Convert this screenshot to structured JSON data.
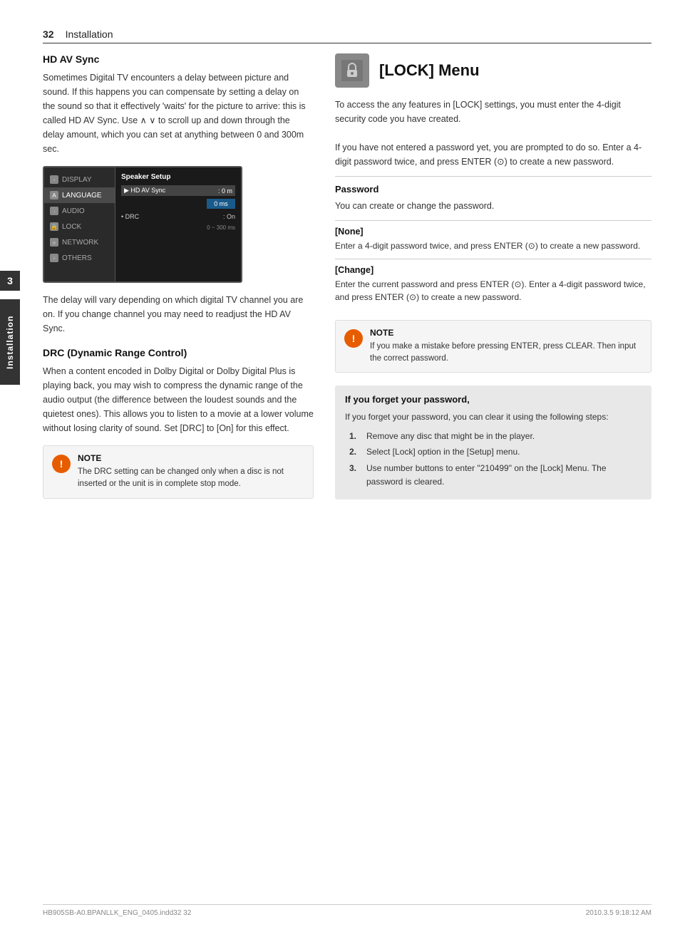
{
  "page": {
    "number": "32",
    "chapter": "Installation",
    "footer_left": "HB905SB-A0.BPANLLK_ENG_0405.indd32   32",
    "footer_right": "2010.3.5   9:18:12 AM"
  },
  "side_tab": {
    "number": "3",
    "label": "Installation"
  },
  "left_section": {
    "hd_av_sync": {
      "heading": "HD AV Sync",
      "body1": "Sometimes Digital TV encounters a delay between picture and sound. If this happens you can compensate by setting a delay on the sound so that it effectively 'waits' for the picture to arrive: this is called HD AV Sync. Use ∧ ∨ to scroll up and down through the delay amount, which you can set at anything between 0 and 300m sec.",
      "body2": "The delay will vary depending on which digital TV channel you are on. If you change channel you may need to readjust the HD AV Sync."
    },
    "menu": {
      "items": [
        {
          "label": "DISPLAY",
          "icon": "display"
        },
        {
          "label": "LANGUAGE",
          "icon": "language",
          "active": true
        },
        {
          "label": "AUDIO",
          "icon": "audio"
        },
        {
          "label": "LOCK",
          "icon": "lock"
        },
        {
          "label": "NETWORK",
          "icon": "network"
        },
        {
          "label": "OTHERS",
          "icon": "others"
        }
      ],
      "right_title": "Speaker Setup",
      "right_items": [
        {
          "label": "▶ HD AV Sync",
          "value": ": 0 m",
          "selected": true
        },
        {
          "label": "• DRC",
          "value": ": On"
        }
      ],
      "value_display": "0 ms",
      "range": "0 ~ 300 ms"
    },
    "drc": {
      "heading": "DRC (Dynamic Range Control)",
      "body": "When a content encoded in Dolby Digital or Dolby Digital Plus is playing back, you may wish to compress the dynamic range of the audio output (the difference between the loudest sounds and the quietest ones). This allows you to listen to a movie at a lower volume without losing clarity of sound. Set [DRC] to [On] for this effect."
    },
    "note_drc": {
      "icon": "!",
      "title": "NOTE",
      "text": "The DRC setting can be changed only when a disc is not inserted or the unit is in complete stop mode."
    }
  },
  "right_section": {
    "lock_menu": {
      "heading": "[LOCK] Menu",
      "icon_label": "lock-icon",
      "body": "To access the any features in [LOCK] settings, you must enter the 4-digit security code you have created.\nIf you have not entered a password yet, you are prompted to do so. Enter a 4-digit password twice, and press ENTER (⊙) to create a new password."
    },
    "password": {
      "heading": "Password",
      "description": "You can create or change the password.",
      "options": [
        {
          "label": "[None]",
          "text": "Enter a 4-digit password twice, and press ENTER (⊙) to create a new password."
        },
        {
          "label": "[Change]",
          "text": "Enter the current password and press ENTER (⊙). Enter a 4-digit password twice, and press ENTER (⊙) to create a new password."
        }
      ]
    },
    "note_lock": {
      "icon": "!",
      "title": "NOTE",
      "text": "If you make a mistake before pressing ENTER, press CLEAR. Then input the correct password."
    },
    "forget_box": {
      "heading": "If you forget your password,",
      "intro": "If you forget your password, you can clear it using the following steps:",
      "steps": [
        "Remove any disc that might be in the player.",
        "Select [Lock] option in the [Setup] menu.",
        "Use number buttons to enter \"210499\" on the [Lock] Menu. The password is cleared."
      ]
    }
  }
}
